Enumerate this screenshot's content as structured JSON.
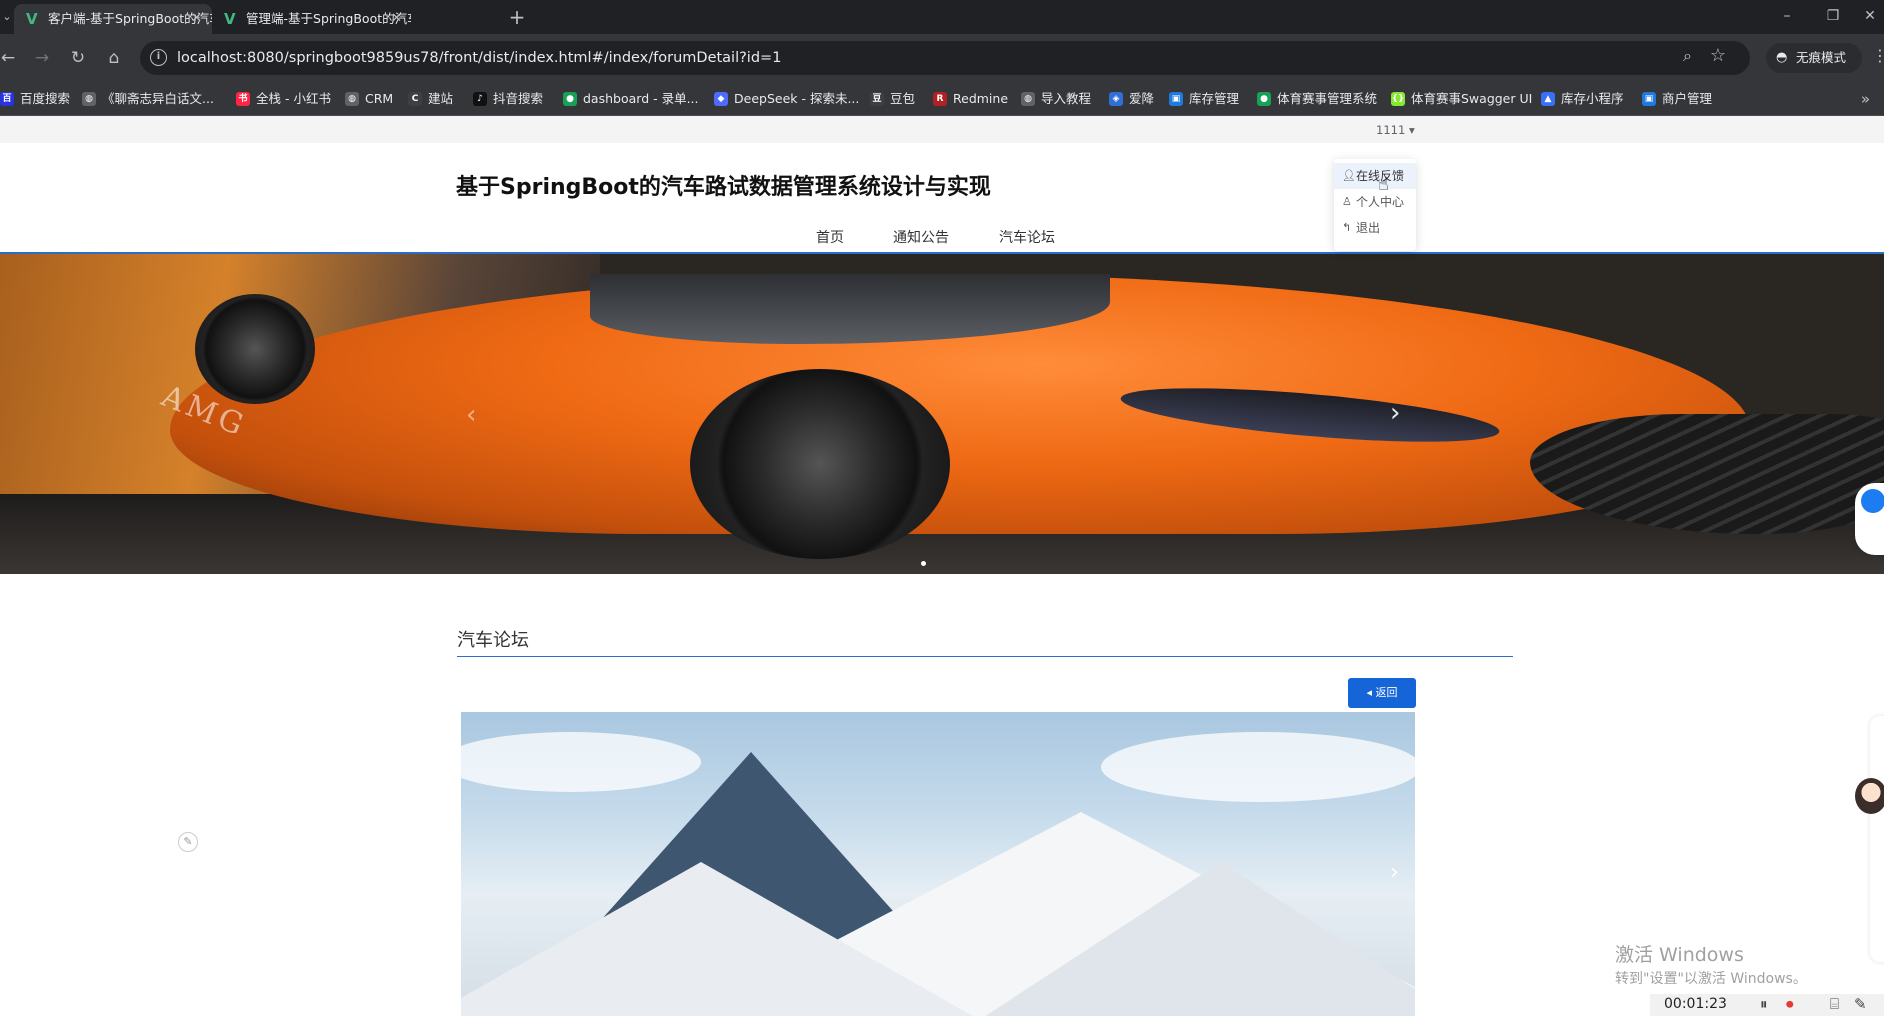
{
  "browser": {
    "tabs": [
      {
        "title": "客户端-基于SpringBoot的汽车",
        "active": true
      },
      {
        "title": "管理端-基于SpringBoot的汽车",
        "active": false
      }
    ],
    "url": "localhost:8080/springboot9859us78/front/dist/index.html#/index/forumDetail?id=1",
    "incognito_label": "无痕模式",
    "bookmarks": [
      {
        "label": "百度搜索",
        "icon": "baidu-icon",
        "color": "#2932e1"
      },
      {
        "label": "《聊斋志异白话文...",
        "icon": "globe-icon",
        "color": "#5f6368"
      },
      {
        "label": "全栈 - 小红书",
        "icon": "xiaohongshu-icon",
        "color": "#ff2442"
      },
      {
        "label": "CRM",
        "icon": "globe-icon",
        "color": "#5f6368"
      },
      {
        "label": "建站",
        "icon": "site-icon",
        "color": "#3c4043"
      },
      {
        "label": "抖音搜索",
        "icon": "douyin-icon",
        "color": "#111111"
      },
      {
        "label": "dashboard - 录单...",
        "icon": "dashboard-icon",
        "color": "#18a058"
      },
      {
        "label": "DeepSeek - 探索未...",
        "icon": "deepseek-icon",
        "color": "#4d6bfe"
      },
      {
        "label": "豆包",
        "icon": "doubao-icon",
        "color": "#3c4043"
      },
      {
        "label": "Redmine",
        "icon": "redmine-icon",
        "color": "#b32024"
      },
      {
        "label": "导入教程",
        "icon": "globe-icon",
        "color": "#5f6368"
      },
      {
        "label": "爱降",
        "icon": "shield-icon",
        "color": "#2f6fd6"
      },
      {
        "label": "库存管理",
        "icon": "app-icon",
        "color": "#1f7ae0"
      },
      {
        "label": "体育赛事管理系统",
        "icon": "leaf-icon",
        "color": "#18a058"
      },
      {
        "label": "体育赛事Swagger UI",
        "icon": "swagger-icon",
        "color": "#85ea2d"
      },
      {
        "label": "库存小程序",
        "icon": "triangle-icon",
        "color": "#3b6ff5"
      },
      {
        "label": "商户管理",
        "icon": "app-icon",
        "color": "#1f7ae0"
      }
    ]
  },
  "page": {
    "user_menu_label": "1111",
    "site_title": "基于SpringBoot的汽车路试数据管理系统设计与实现",
    "nav": [
      "首页",
      "通知公告",
      "汽车论坛"
    ],
    "dropdown": [
      {
        "label": "在线反馈",
        "icon": "user-icon"
      },
      {
        "label": "个人中心",
        "icon": "user-outline-icon"
      },
      {
        "label": "退出",
        "icon": "logout-icon"
      }
    ],
    "section_title": "汽车论坛",
    "back_label": "返回",
    "accent_color": "#2a6dcc",
    "button_color": "#1565d8"
  },
  "overlay": {
    "watermark_title": "激活 Windows",
    "watermark_sub": "转到\"设置\"以激活 Windows。",
    "recording_time": "00:01:23"
  }
}
